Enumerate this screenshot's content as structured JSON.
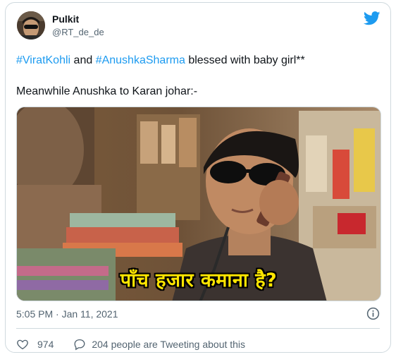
{
  "author": {
    "name": "Pulkit",
    "handle": "@RT_de_de"
  },
  "tweet": {
    "line1_hashtag1": "#ViratKohli",
    "line1_mid": " and ",
    "line1_hashtag2": "#AnushkaSharma",
    "line1_end": " blessed with baby girl**",
    "line2": "Meanwhile Anushka to Karan johar:-"
  },
  "media": {
    "caption": "पाँच हजार कमाना है?"
  },
  "meta": {
    "timestamp": "5:05 PM · Jan 11, 2021"
  },
  "engagement": {
    "likes": "974",
    "conversation": "204 people are Tweeting about this"
  },
  "icons": {
    "brand": "twitter-bird-icon",
    "info": "info-icon",
    "like": "heart-icon",
    "reply": "speech-bubble-icon"
  },
  "colors": {
    "hashtag": "#1d9bf0",
    "text": "#0f1419",
    "secondary": "#536471",
    "border": "#cfd9de",
    "caption": "#ffe600"
  }
}
